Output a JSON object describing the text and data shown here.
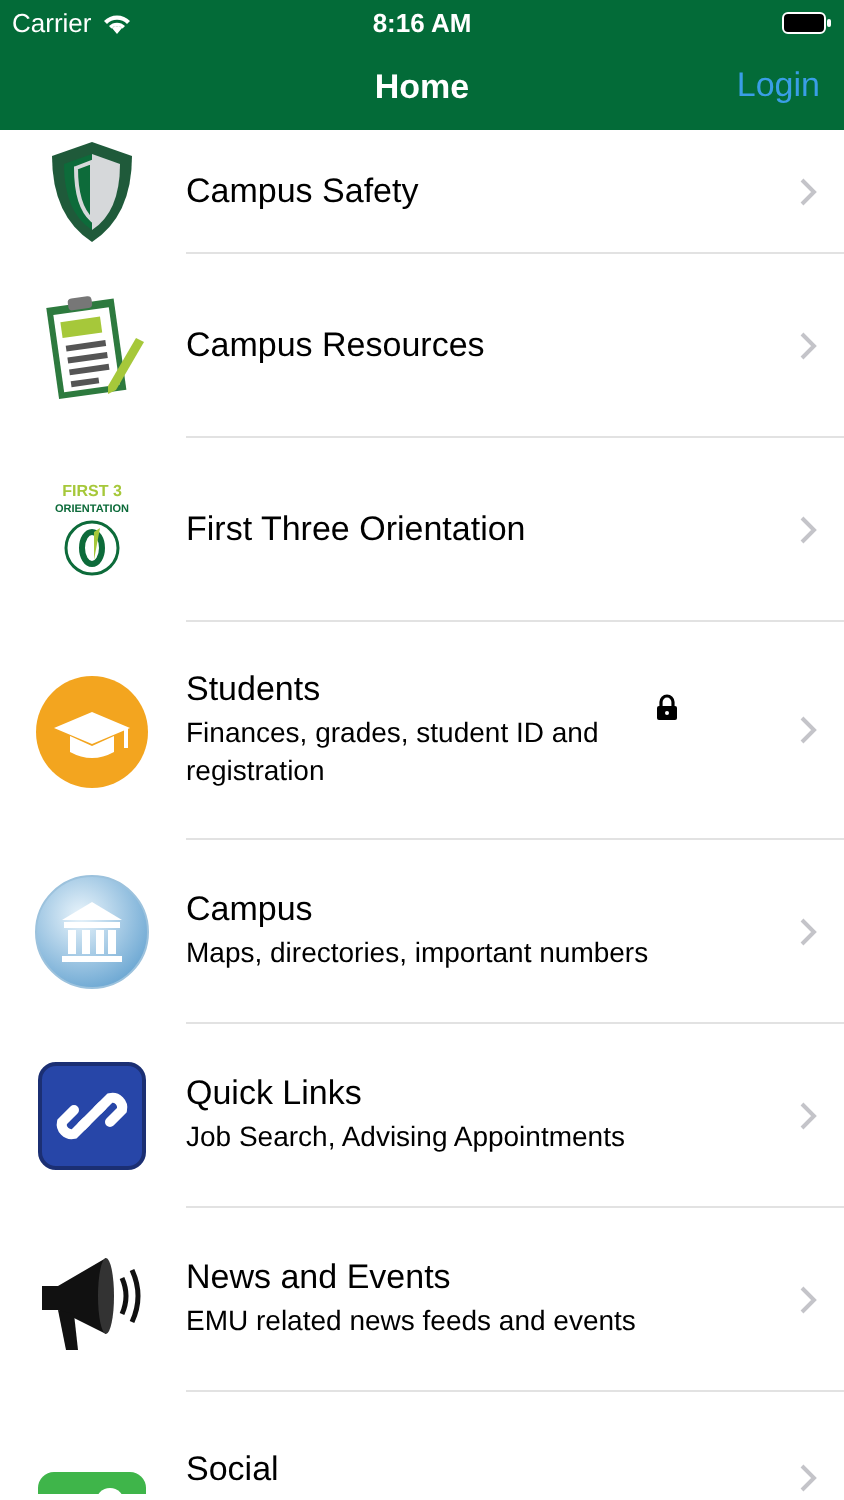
{
  "status_bar": {
    "carrier": "Carrier",
    "time": "8:16 AM"
  },
  "nav_bar": {
    "title": "Home",
    "action": "Login"
  },
  "items": [
    {
      "title": "Campus Safety",
      "locked": false
    },
    {
      "title": "Campus Resources",
      "locked": false
    },
    {
      "title": "First Three Orientation",
      "logo_lines": [
        "FIRST 3",
        "ORIENTATION"
      ],
      "locked": false
    },
    {
      "title": "Students",
      "subtitle": "Finances, grades, student ID and registration",
      "locked": true
    },
    {
      "title": "Campus",
      "subtitle": "Maps, directories, important numbers",
      "locked": false
    },
    {
      "title": "Quick Links",
      "subtitle": "Job Search, Advising Appointments",
      "locked": false
    },
    {
      "title": "News and Events",
      "subtitle": "EMU related news feeds and events",
      "locked": false
    },
    {
      "title": "Social",
      "locked": false
    }
  ]
}
